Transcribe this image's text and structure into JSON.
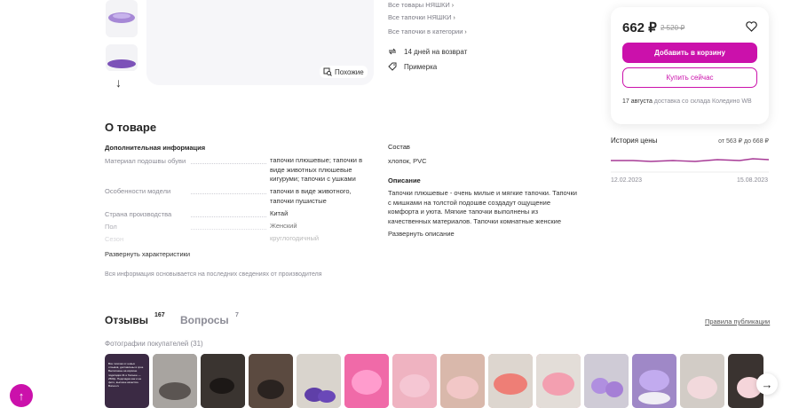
{
  "gallery": {
    "similar_label": "Похожие"
  },
  "links": [
    {
      "label": "Все товары НЯШКИ"
    },
    {
      "label": "Все тапочки НЯШКИ"
    },
    {
      "label": "Все тапочки в категории"
    }
  ],
  "features": {
    "return_label": "14 дней на возврат",
    "fitting_label": "Примерка"
  },
  "price_card": {
    "price": "662 ₽",
    "old_price": "2 520 ₽",
    "add_to_cart": "Добавить в корзину",
    "buy_now": "Купить сейчас",
    "delivery_date": "17 августа",
    "delivery_text": " доставка со склада Коледино WB"
  },
  "price_history": {
    "title": "История цены",
    "range": "от 563 ₽ до 668 ₽",
    "start_date": "12.02.2023",
    "end_date": "15.08.2023",
    "line_color": "#a73a96"
  },
  "about": {
    "title": "О товаре",
    "additional_title": "Дополнительная информация",
    "characteristics": [
      {
        "name": "Материал подошвы обуви",
        "value": "тапочки плюшевые; тапочки в виде животных плюшевые кигуруми; тапочки с ушками"
      },
      {
        "name": "Особенности модели",
        "value": "тапочки в виде животного, тапочки пушистые"
      },
      {
        "name": "Страна производства",
        "value": "Китай"
      },
      {
        "name": "Пол",
        "value": "Женский"
      },
      {
        "name": "Сезон",
        "value": "круглогодичный"
      }
    ],
    "expand_chars": "Развернуть характеристики",
    "note": "Вся информация основывается на последних сведениях от производителя",
    "composition_title": "Состав",
    "composition_value": "хлопок, PVC",
    "description_title": "Описание",
    "description_text": "Тапочки плюшевые - очень милые и мягкие тапочки. Тапочки с мишками на толстой подошве создадут ощущение комфорта и уюта. Мягкие тапочки выполнены из качественных материалов. Тапочки комнатные женские благодаря подошве из ПВХ очень",
    "expand_description": "Развернуть описание"
  },
  "reviews": {
    "reviews_tab": "Отзывы",
    "reviews_count": "167",
    "questions_tab": "Вопросы",
    "questions_count": "7",
    "rules_link": "Правила публикации",
    "photos_title": "Фотографии покупателей (31)",
    "first_photo_note": "Все тапочки от новых отзывов, доставлены в срок. Выполнены на корзине подкладки 41 и больше — 2500р. Подкладка как и на фото, высокое качество. Buneo.ru"
  },
  "colors": {
    "accent": "#cb11ab",
    "photo_colors": [
      "#3b2a44",
      "#8d8a88",
      "#2d2724",
      "#4a3b34",
      "#d9d4cd",
      "#ec5aa0",
      "#e79ab1",
      "#e7b9b3",
      "#e6837e",
      "#f08da0",
      "#b8a7cc",
      "#ad93d4",
      "#cfc9c4",
      "#e9c9c6",
      "#3a3330"
    ]
  },
  "icons": {
    "return": "return-arrows-icon",
    "fitting": "tag-icon",
    "similar": "search-similar-icon",
    "favorite": "heart-icon",
    "next": "arrow-right-icon",
    "up": "arrow-up-icon",
    "gallery_down": "arrow-down-icon"
  }
}
